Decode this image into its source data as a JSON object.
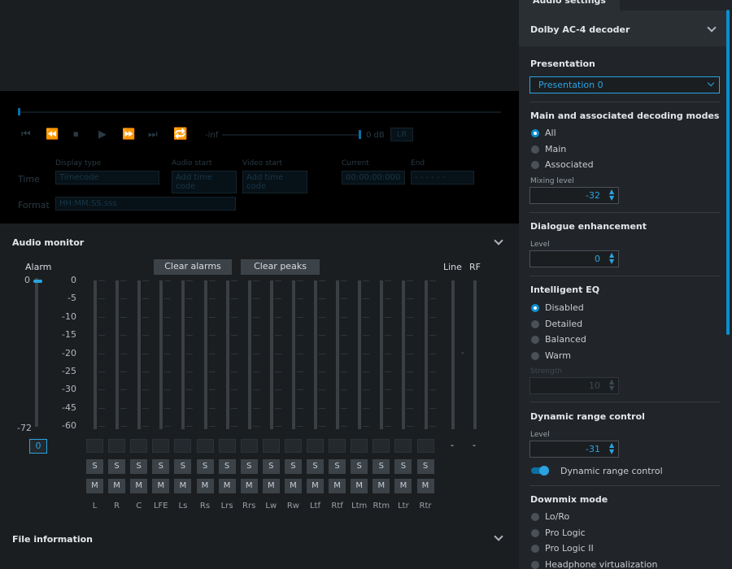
{
  "tab_title": "Audio settings",
  "player": {
    "volume_min": "-inf",
    "volume_max": "0 dB",
    "lr_badge": "LR",
    "display_type_label": "Display type",
    "display_type_value": "Timecode",
    "audio_start_label": "Audio start",
    "audio_start_value": "Add time code",
    "video_start_label": "Video start",
    "video_start_value": "Add time code",
    "current_label": "Current",
    "current_value": "00:00:00:000",
    "end_label": "End",
    "end_value": "- - - - - -",
    "time_label": "Time",
    "format_label": "Format",
    "format_value": "HH:MM:SS.sss"
  },
  "monitor": {
    "title": "Audio monitor",
    "alarm_label": "Alarm",
    "alarm_top": "0",
    "alarm_bottom": "-72",
    "alarm_value": "0",
    "clear_alarms": "Clear alarms",
    "clear_peaks": "Clear peaks",
    "line_label": "Line",
    "rf_label": "RF",
    "scale": [
      "0",
      "-5",
      "-10",
      "-15",
      "-20",
      "-25",
      "-30",
      "-45",
      "-60"
    ],
    "channels": [
      "L",
      "R",
      "C",
      "LFE",
      "Ls",
      "Rs",
      "Lrs",
      "Rrs",
      "Lw",
      "Rw",
      "Ltf",
      "Rtf",
      "Ltm",
      "Rtm",
      "Ltr",
      "Rtr"
    ],
    "solo_label": "S",
    "mute_label": "M",
    "line_dash": "-",
    "rf_dash": "-",
    "mid_dash": "-"
  },
  "file_info": {
    "title": "File information"
  },
  "decoder": {
    "title": "Dolby AC-4 decoder",
    "presentation_label": "Presentation",
    "presentation_value": "Presentation 0",
    "decoding_modes_title": "Main and associated decoding modes",
    "decoding_modes": [
      "All",
      "Main",
      "Associated"
    ],
    "mixing_level_label": "Mixing level",
    "mixing_level_value": "-32",
    "dialogue_title": "Dialogue enhancement",
    "dialogue_level_label": "Level",
    "dialogue_level_value": "0",
    "ieq_title": "Intelligent EQ",
    "ieq_options": [
      "Disabled",
      "Detailed",
      "Balanced",
      "Warm"
    ],
    "strength_label": "Strength",
    "strength_value": "10",
    "drc_title": "Dynamic range control",
    "drc_level_label": "Level",
    "drc_level_value": "-31",
    "drc_toggle_label": "Dynamic range control",
    "downmix_title": "Downmix mode",
    "downmix_options": [
      "Lo/Ro",
      "Pro Logic",
      "Pro Logic II",
      "Headphone virtualization"
    ]
  },
  "colors": {
    "accent": "#0a8fd0",
    "panel": "#212529",
    "background": "#1b1e21"
  }
}
